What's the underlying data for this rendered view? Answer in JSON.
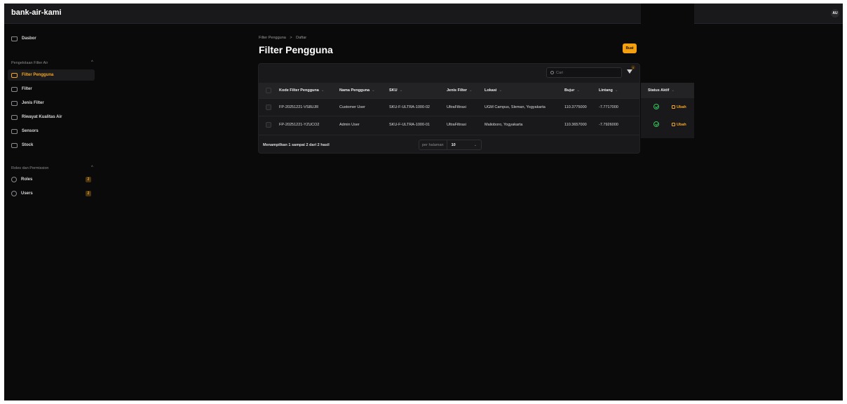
{
  "app": {
    "brand": "bank-air-kami",
    "avatar_initials": "AU"
  },
  "sidebar": {
    "dashboard": {
      "label": "Dasbor",
      "icon": "home-icon"
    },
    "groups": [
      {
        "label": "Pengelolaan Filter Air",
        "items": [
          {
            "label": "Filter Pengguna",
            "icon": "box-icon",
            "active": true
          },
          {
            "label": "Filter",
            "icon": "box-icon"
          },
          {
            "label": "Jenis Filter",
            "icon": "box-icon"
          },
          {
            "label": "Riwayat Kualitas Air",
            "icon": "chart-icon"
          },
          {
            "label": "Sensors",
            "icon": "box-icon"
          },
          {
            "label": "Stock",
            "icon": "box-icon"
          }
        ]
      },
      {
        "label": "Roles dan Permission",
        "items": [
          {
            "label": "Roles",
            "icon": "shield-icon",
            "badge": "2"
          },
          {
            "label": "Users",
            "icon": "users-icon",
            "badge": "2"
          }
        ]
      }
    ]
  },
  "page": {
    "breadcrumb": [
      "Filter Pengguna",
      "Daftar"
    ],
    "breadcrumb_sep": ">",
    "title": "Filter Pengguna",
    "create_label": "Buat"
  },
  "table": {
    "search_placeholder": "Cari",
    "filter_count": "0",
    "columns": [
      "Kode Filter Pengguna",
      "Nama Pengguna",
      "SKU",
      "Jenis Filter",
      "Lokasi",
      "Bujur",
      "Lintang",
      "Status Aktif"
    ],
    "rows": [
      {
        "kode": "FP-20251221-VS8UJR",
        "nama": "Customer User",
        "sku": "SKU-F-ULTRA-1000-02",
        "jenis": "UltraFiltrasi",
        "lokasi": "UGM Campus, Sleman, Yogyakarta",
        "bujur": "110.3775000",
        "lintang": "-7.7717000",
        "aktif": true,
        "action": "Ubah"
      },
      {
        "kode": "FP-20251221-YZUCO2",
        "nama": "Admin User",
        "sku": "SKU-F-ULTRA-1000-01",
        "jenis": "UltraFiltrasi",
        "lokasi": "Malioboro, Yogyakarta",
        "bujur": "110.3657000",
        "lintang": "-7.7926000",
        "aktif": true,
        "action": "Ubah"
      }
    ],
    "summary": "Menampilkan 1 sampai 2 dari 2 hasil",
    "per_page_label": "per halaman",
    "per_page_value": "10"
  },
  "colors": {
    "accent": "#f5a623",
    "success": "#34c759",
    "background": "#0a0a0b"
  }
}
